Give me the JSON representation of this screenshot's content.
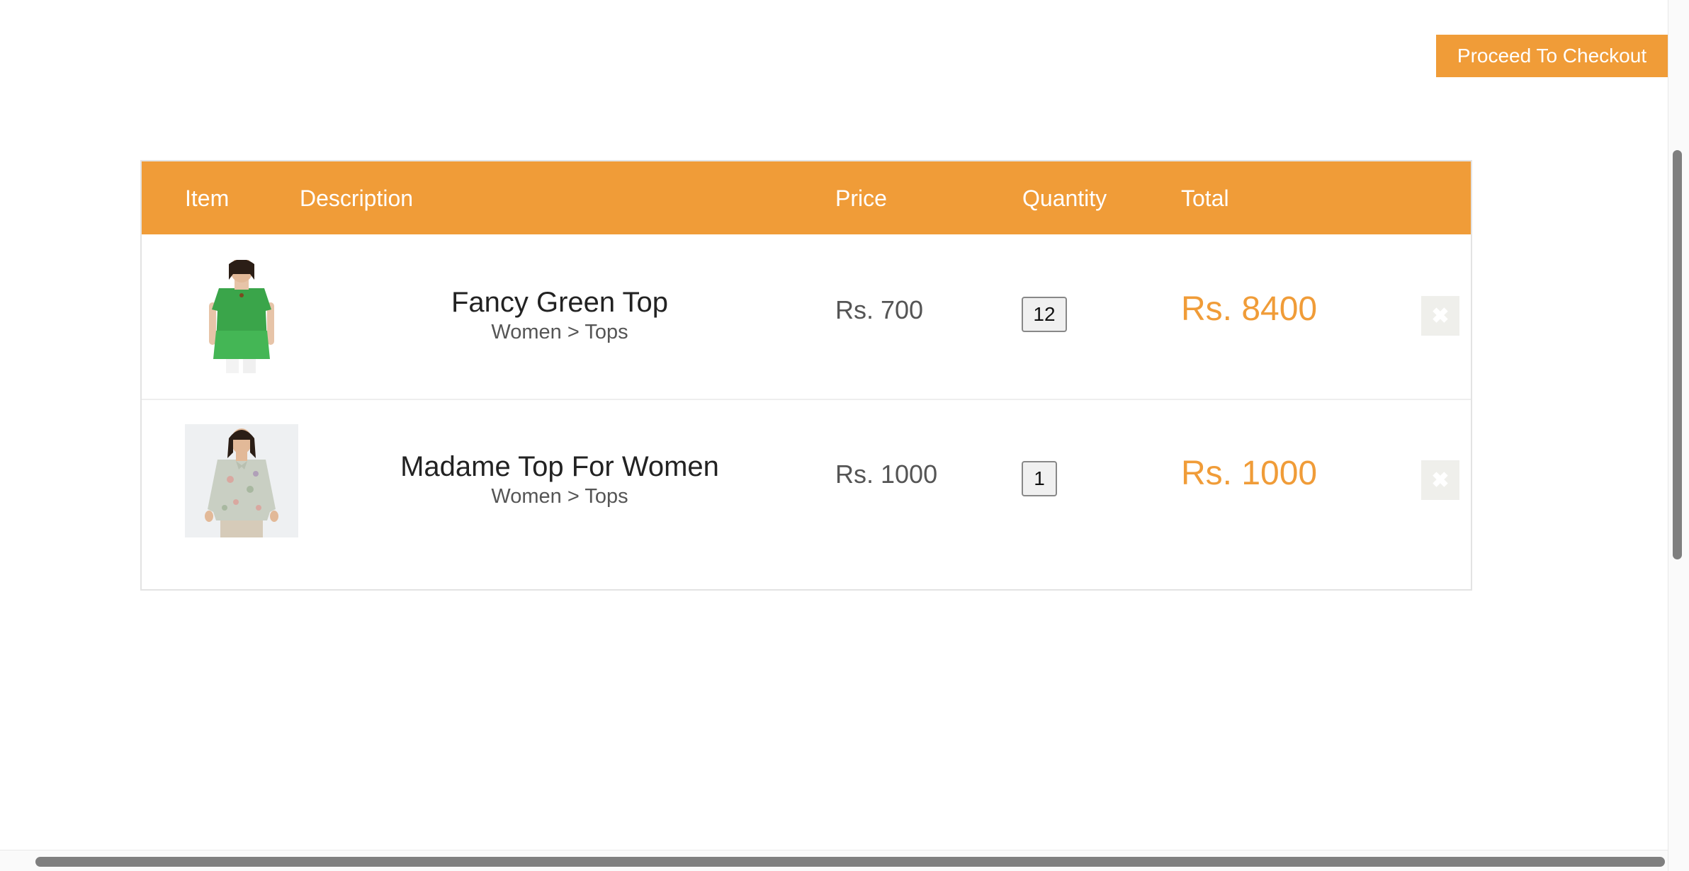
{
  "toolbar": {
    "checkout_label": "Proceed To Checkout"
  },
  "cart": {
    "headers": {
      "item": "Item",
      "description": "Description",
      "price": "Price",
      "quantity": "Quantity",
      "total": "Total"
    },
    "rows": [
      {
        "name": "Fancy Green Top",
        "category": "Women > Tops",
        "price": "Rs. 700",
        "quantity": "12",
        "total": "Rs. 8400",
        "image_icon": "green-top-product-image"
      },
      {
        "name": "Madame Top For Women",
        "category": "Women > Tops",
        "price": "Rs. 1000",
        "quantity": "1",
        "total": "Rs. 1000",
        "image_icon": "floral-top-product-image"
      }
    ],
    "remove_icon": "close-icon"
  },
  "colors": {
    "accent": "#f09c38",
    "header_text": "#ffffff",
    "remove_button_bg": "#efefeb"
  }
}
